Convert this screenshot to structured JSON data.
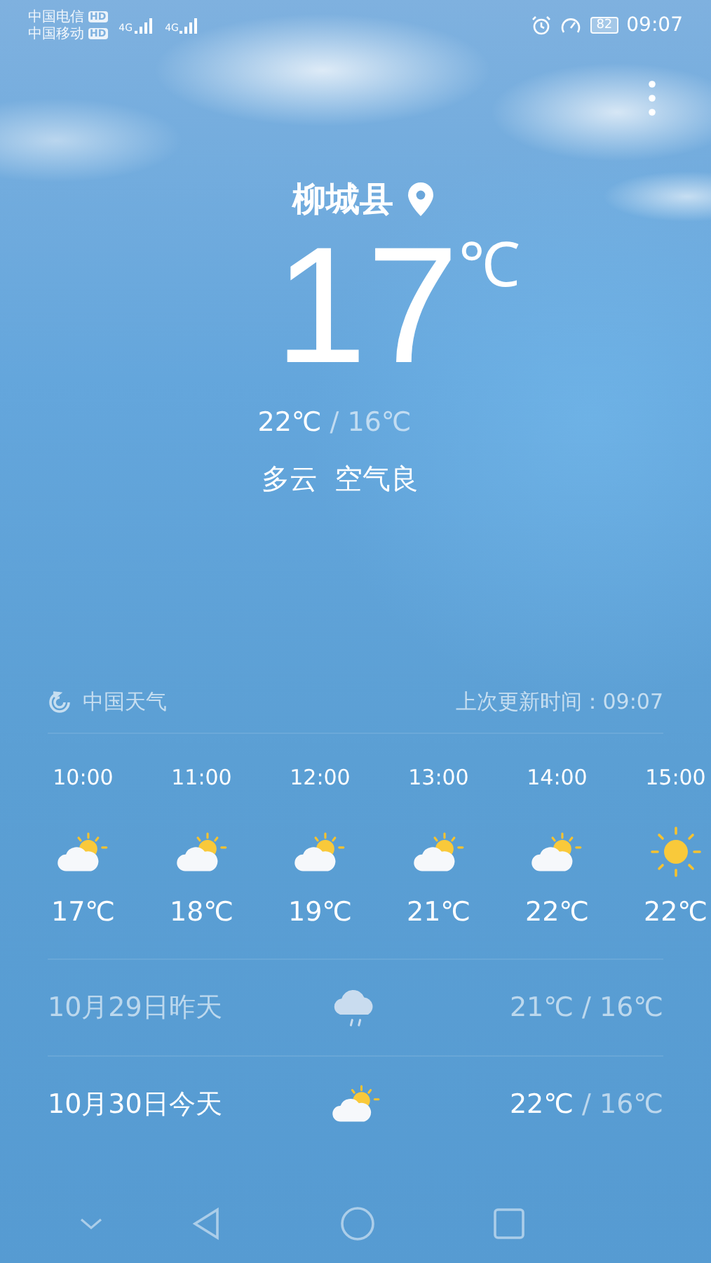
{
  "status_bar": {
    "carriers": [
      {
        "name": "中国电信",
        "badge": "HD",
        "network": "4G"
      },
      {
        "name": "中国移动",
        "badge": "HD",
        "network": "4G"
      }
    ],
    "battery": "82",
    "time": "09:07"
  },
  "current": {
    "city": "柳城县",
    "temperature": "17",
    "unit": "℃",
    "high": "22℃",
    "separator": "/",
    "low": "16℃",
    "condition": "多云",
    "air_quality": "空气良"
  },
  "source": {
    "name": "中国天气",
    "updated": "上次更新时间：09:07"
  },
  "hourly": [
    {
      "time": "10:00",
      "kind": "partly_cloudy",
      "temperature": "17℃"
    },
    {
      "time": "11:00",
      "kind": "partly_cloudy",
      "temperature": "18℃"
    },
    {
      "time": "12:00",
      "kind": "partly_cloudy",
      "temperature": "19℃"
    },
    {
      "time": "13:00",
      "kind": "partly_cloudy",
      "temperature": "21℃"
    },
    {
      "time": "14:00",
      "kind": "partly_cloudy",
      "temperature": "22℃"
    },
    {
      "time": "15:00",
      "kind": "sunny",
      "temperature": "22℃"
    }
  ],
  "daily": [
    {
      "date": "10月29日昨天",
      "kind": "rain",
      "high": "21℃",
      "separator": "/",
      "low": "16℃",
      "past": true
    },
    {
      "date": "10月30日今天",
      "kind": "partly_cloudy",
      "high": "22℃",
      "separator": "/",
      "low": "16℃",
      "past": false
    }
  ]
}
